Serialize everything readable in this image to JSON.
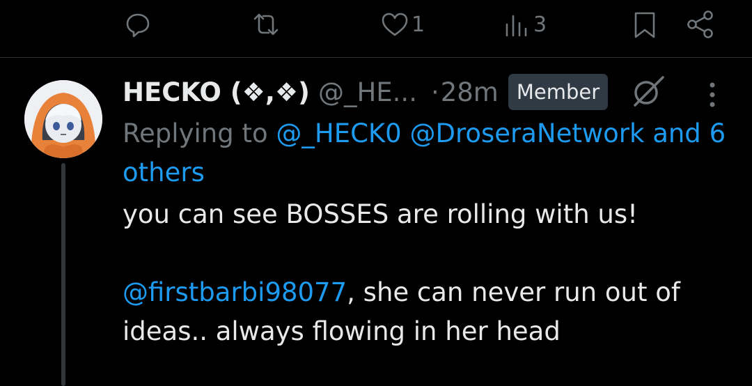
{
  "actions": {
    "reply": {
      "icon": "reply-icon",
      "count": ""
    },
    "retweet": {
      "icon": "retweet-icon",
      "count": ""
    },
    "like": {
      "icon": "heart-icon",
      "count": "1"
    },
    "views": {
      "icon": "views-icon",
      "count": "3"
    },
    "bookmark": {
      "icon": "bookmark-icon"
    },
    "share": {
      "icon": "share-icon"
    }
  },
  "post": {
    "author_name": "HECKO (❖,❖)",
    "author_handle": "@_HE...",
    "separator": "·",
    "time": "28m",
    "badge": "Member",
    "replying_prefix": "Replying to",
    "replying_mentions": "@_HECK0 @DroseraNetwork",
    "replying_and": "and",
    "replying_others": "6 others",
    "body_line1": "you can see BOSSES are rolling with us!",
    "body_mention": "@firstbarbi98077",
    "body_rest": ", she can never run out of ideas.. always flowing in her head"
  },
  "colors": {
    "background": "#000000",
    "link": "#1d9bf0",
    "muted": "#71767b",
    "text": "#e7e9ea",
    "badge_bg": "#2f3a44"
  }
}
